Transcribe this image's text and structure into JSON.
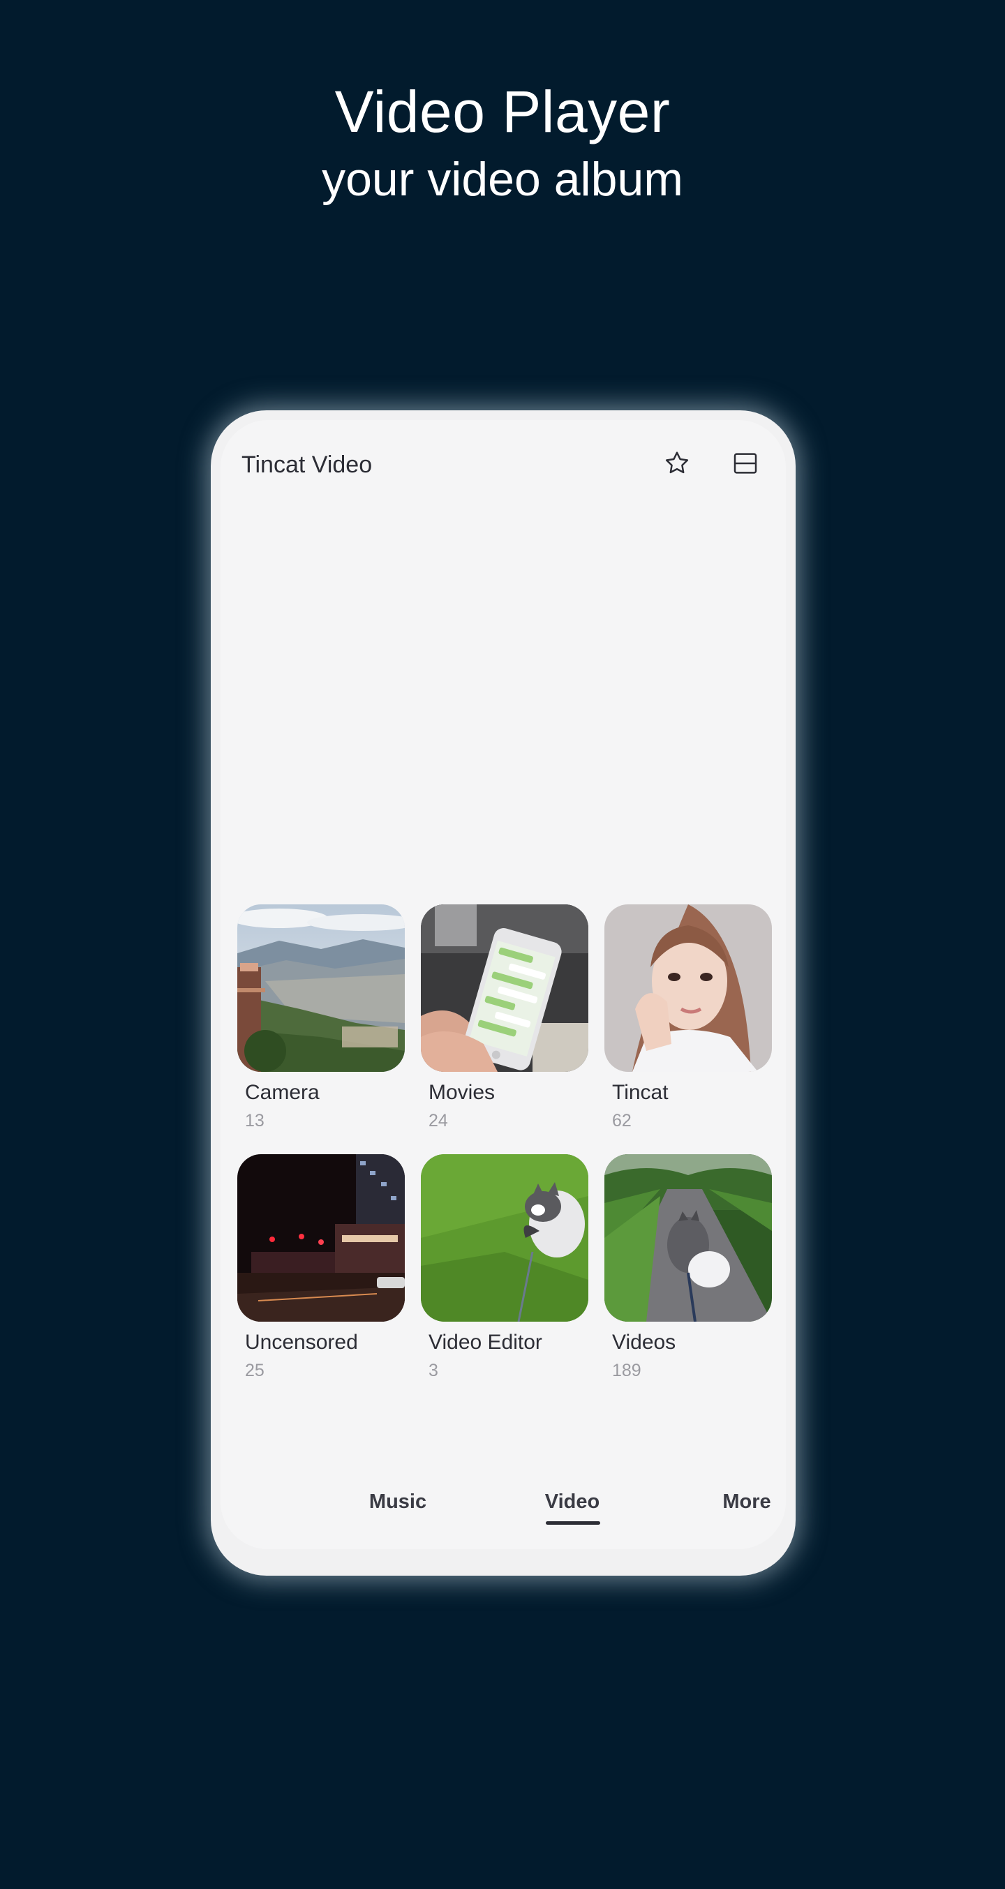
{
  "promo": {
    "title": "Video Player",
    "subtitle": "your video album"
  },
  "app": {
    "title": "Tincat Video",
    "favorites_icon": "star-icon",
    "layout_icon": "view-layout-icon"
  },
  "albums": [
    {
      "name": "Camera",
      "count": "13"
    },
    {
      "name": "Movies",
      "count": "24"
    },
    {
      "name": "Tincat",
      "count": "62"
    },
    {
      "name": "Uncensored",
      "count": "25"
    },
    {
      "name": "Video Editor",
      "count": "3"
    },
    {
      "name": "Videos",
      "count": "189"
    }
  ],
  "nav": {
    "items": [
      {
        "label": "Music"
      },
      {
        "label": "Video"
      },
      {
        "label": "More"
      }
    ],
    "active": "Video"
  },
  "colors": {
    "background": "#021b2d",
    "screen": "#f5f5f6",
    "text": "#2c2d35",
    "muted": "#9a9aa0"
  }
}
